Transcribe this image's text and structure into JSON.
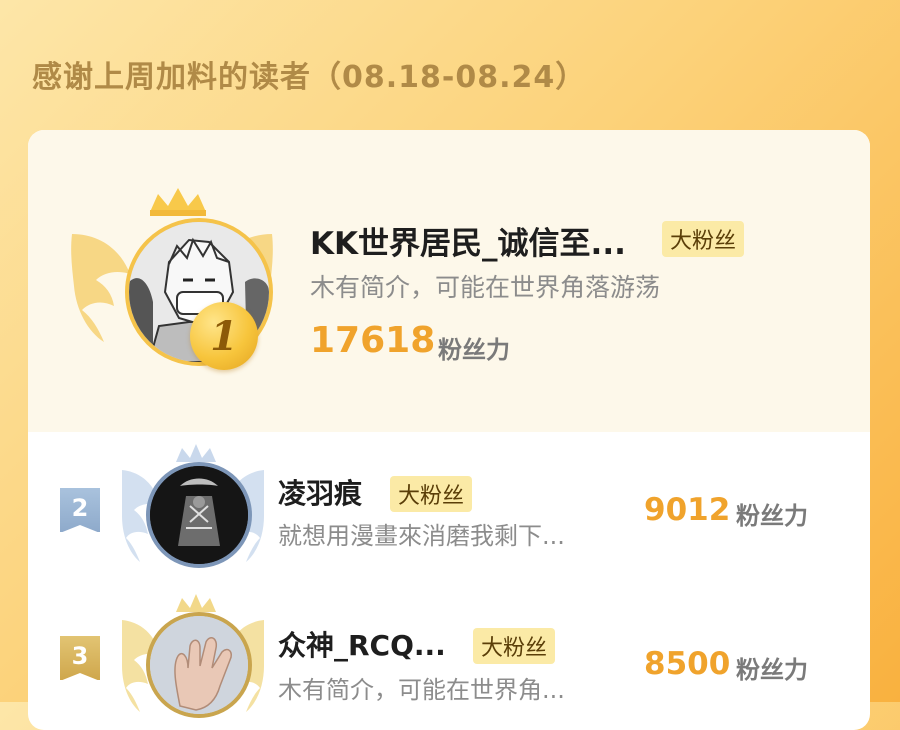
{
  "header": {
    "title": "感谢上周加料的读者（08.18-08.24）"
  },
  "fan_tag_label": "大粉丝",
  "score_unit": "粉丝力",
  "top_fan": {
    "rank": "1",
    "name": "KK世界居民_诚信至...",
    "bio": "木有简介，可能在世界角落游荡",
    "score": "17618"
  },
  "fans": [
    {
      "rank": "2",
      "name": "凌羽痕",
      "bio": "就想用漫畫來消磨我剩下...",
      "score": "9012"
    },
    {
      "rank": "3",
      "name": "众神_RCQ...",
      "bio": "木有简介，可能在世界角...",
      "score": "8500"
    }
  ],
  "colors": {
    "accent": "#f0a32c",
    "gold": "#f7c53c",
    "silver": "#8eaacb",
    "bronze": "#cfa74c",
    "tag_bg": "#fbeaa6"
  }
}
